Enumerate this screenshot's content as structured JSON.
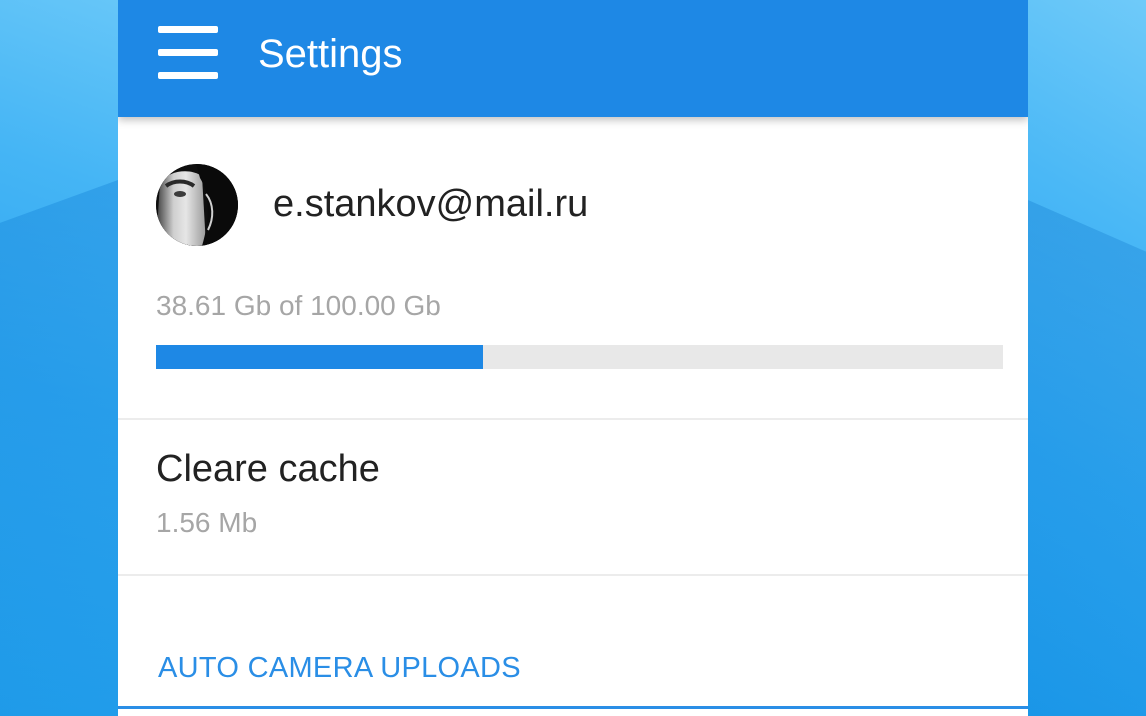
{
  "appbar": {
    "title": "Settings",
    "menu_icon": "hamburger-menu-icon",
    "background_color": "#1e88e5"
  },
  "account": {
    "email": "e.stankov@mail.ru",
    "avatar": "user-avatar-photo",
    "storage_text": "38.61 Gb of 100.00 Gb",
    "storage_used_fraction": 0.3861,
    "progress_color": "#1e88e5"
  },
  "cache": {
    "title": "Cleare cache",
    "size": "1.56 Mb"
  },
  "auto_camera_uploads": {
    "header": "AUTO CAMERA UPLOADS",
    "accent_color": "#2a8ee6"
  }
}
